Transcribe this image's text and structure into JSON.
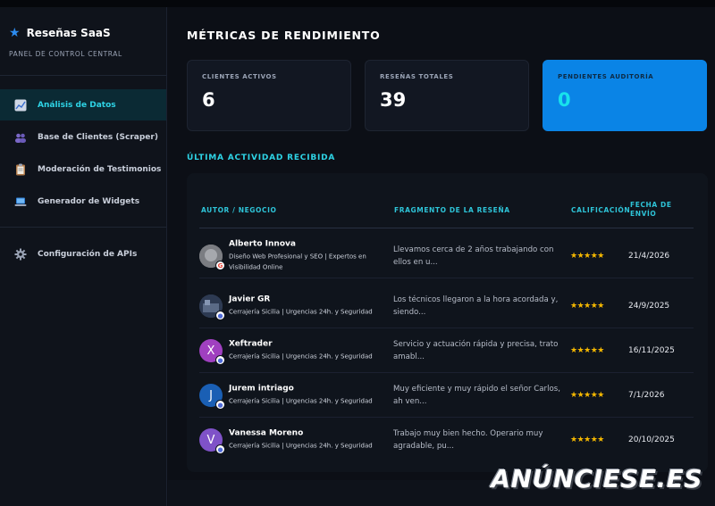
{
  "brand": {
    "name": "Reseñas SaaS",
    "subtitle": "PANEL DE CONTROL CENTRAL",
    "icon": "star-icon"
  },
  "sidebar": {
    "items": [
      {
        "label": "Análisis de Datos",
        "icon": "chart-icon",
        "active": true
      },
      {
        "label": "Base de Clientes (Scraper)",
        "icon": "users-icon",
        "active": false
      },
      {
        "label": "Moderación de Testimonios",
        "icon": "clipboard-icon",
        "active": false
      },
      {
        "label": "Generador de Widgets",
        "icon": "laptop-icon",
        "active": false
      }
    ],
    "settings": {
      "label": "Configuración de APIs",
      "icon": "gear-icon"
    }
  },
  "main": {
    "title": "MÉTRICAS DE RENDIMIENTO",
    "cards": [
      {
        "label": "CLIENTES ACTIVOS",
        "value": "6"
      },
      {
        "label": "RESEÑAS TOTALES",
        "value": "39"
      },
      {
        "label": "PENDIENTES AUDITORÍA",
        "value": "0"
      }
    ],
    "section_title": "ÚLTIMA ACTIVIDAD RECIBIDA",
    "table": {
      "headers": [
        "AUTOR / NEGOCIO",
        "FRAGMENTO DE LA RESEÑA",
        "CALIFICACIÓN",
        "FECHA DE ENVÍO"
      ],
      "rows": [
        {
          "initial": "",
          "name": "Alberto Innova",
          "business": "Diseño Web Profesional y SEO | Expertos en Visibilidad Online",
          "fragment": "Llevamos cerca de 2 años trabajando con ellos en u...",
          "stars": "★★★★★",
          "date": "21/4/2026",
          "badge": "G"
        },
        {
          "initial": "",
          "name": "Javier GR",
          "business": "Cerrajería Sicilia | Urgencias 24h. y Seguridad",
          "fragment": "Los técnicos llegaron a la hora acordada y, siendo...",
          "stars": "★★★★★",
          "date": "24/9/2025",
          "badge": "●"
        },
        {
          "initial": "X",
          "name": "Xeftrader",
          "business": "Cerrajería Sicilia | Urgencias 24h. y Seguridad",
          "fragment": "Servicio y actuación rápida y precisa, trato amabl...",
          "stars": "★★★★★",
          "date": "16/11/2025",
          "badge": "●"
        },
        {
          "initial": "J",
          "name": "Jurem intriago",
          "business": "Cerrajería Sicilia | Urgencias 24h. y Seguridad",
          "fragment": "Muy eficiente y muy rápido el señor Carlos, ah ven...",
          "stars": "★★★★★",
          "date": "7/1/2026",
          "badge": "●"
        },
        {
          "initial": "V",
          "name": "Vanessa Moreno",
          "business": "Cerrajería Sicilia | Urgencias 24h. y Seguridad",
          "fragment": "Trabajo muy bien hecho. Operario muy agradable, pu...",
          "stars": "★★★★★",
          "date": "20/10/2025",
          "badge": "●"
        }
      ]
    }
  },
  "watermark": "ANÚNCIESE.ES",
  "colors": {
    "accent": "#2ed4e6",
    "highlight_card": "#0a84e6",
    "stars": "#f5b800"
  }
}
